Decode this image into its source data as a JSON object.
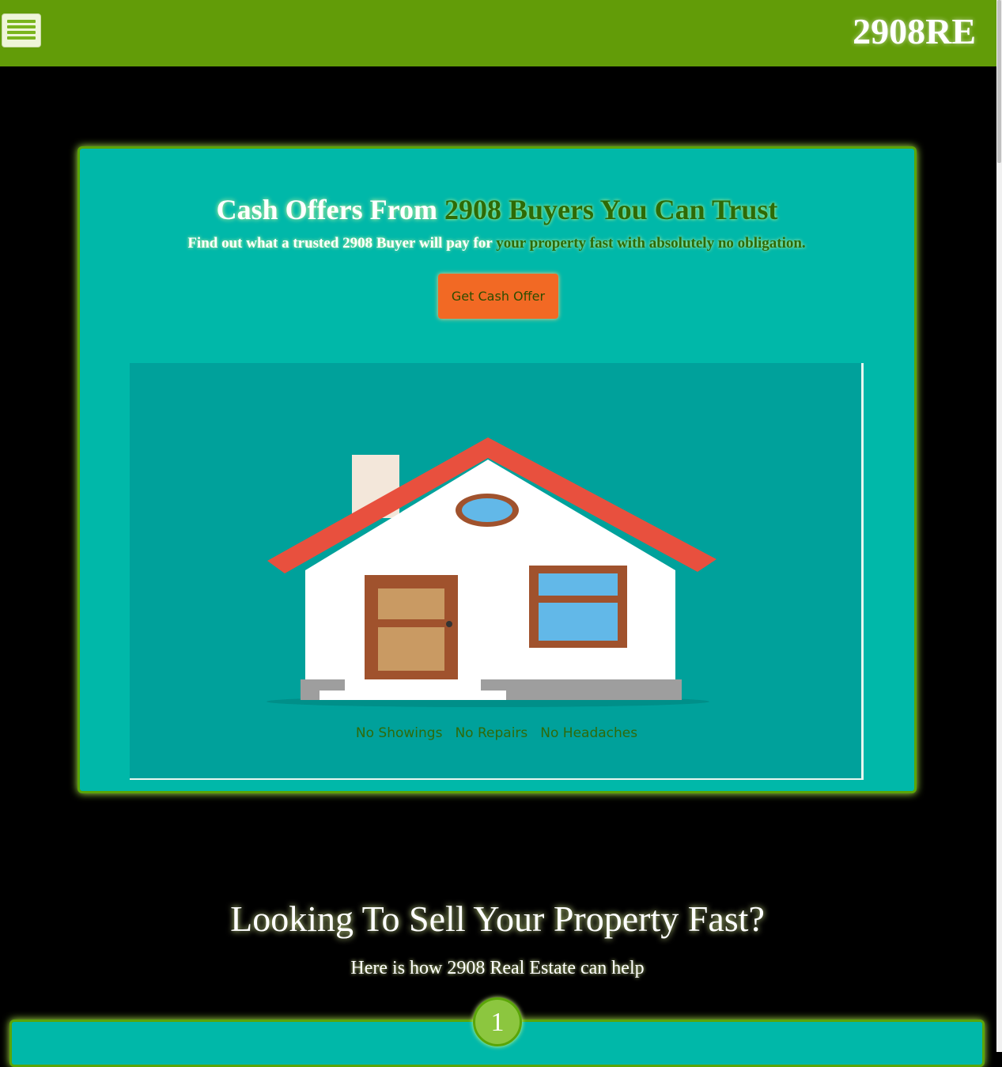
{
  "header": {
    "brand": "2908RE",
    "menu_icon": "hamburger-icon"
  },
  "hero": {
    "title_part1": "Cash Offers From ",
    "title_part2": "2908 Buyers You Can Trust",
    "subtitle_part1": "Find out what a trusted 2908 Buyer will pay for ",
    "subtitle_part2": "your property fast with absolutely no obligation.",
    "cta_label": "Get Cash Offer",
    "perks": [
      "No Showings",
      "No Repairs",
      "No Headaches"
    ]
  },
  "section": {
    "title": "Looking To Sell Your Property Fast?",
    "subtitle": "Here is how 2908 Real Estate can help",
    "step_number": "1"
  },
  "colors": {
    "header_bg": "#629c08",
    "card_bg": "#00b8a9",
    "accent_green": "#2e6a06",
    "cta_orange": "#f26924"
  }
}
